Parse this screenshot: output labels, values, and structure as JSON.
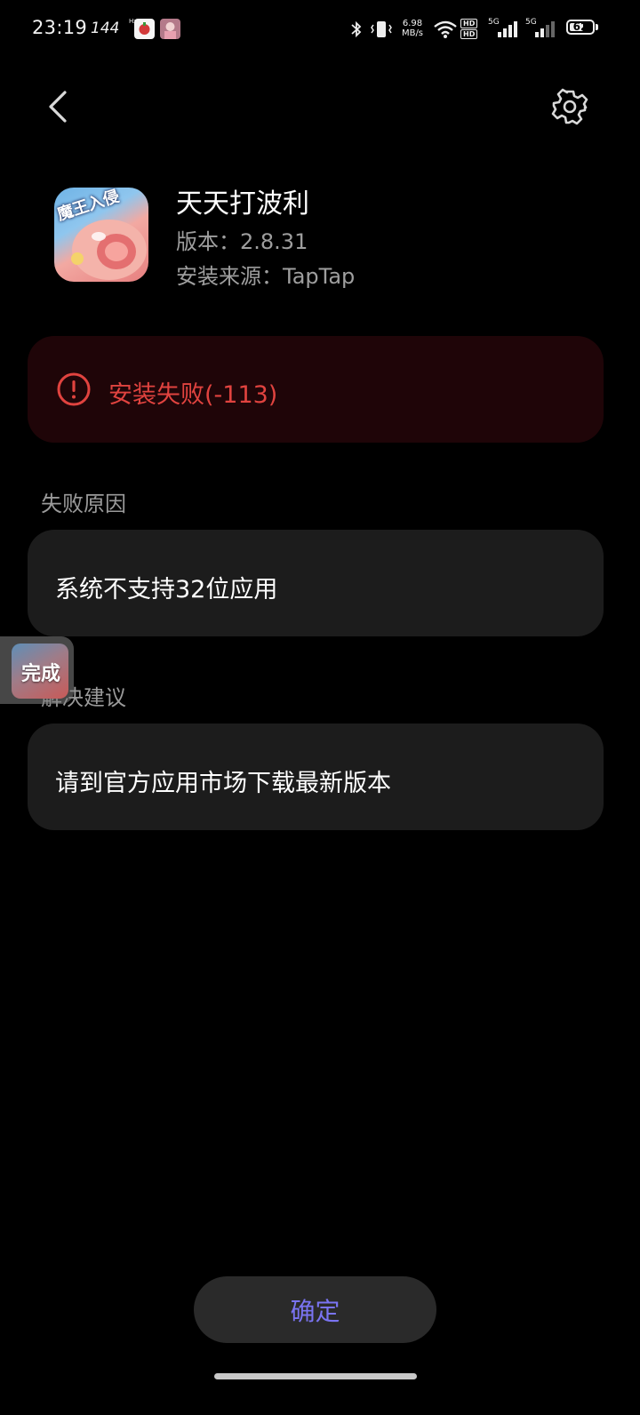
{
  "status_bar": {
    "time": "23:19",
    "refresh_rate": "144",
    "refresh_unit_top": "Hz",
    "net_speed_value": "6.98",
    "net_speed_unit": "MB/s",
    "hd1": "HD",
    "hd2": "HD",
    "signal1_label": "5G",
    "signal2_label": "5G",
    "battery_level": "62",
    "battery_fraction": 0.62,
    "icons": [
      "notification-app-icon",
      "notification-avatar-icon",
      "bluetooth-icon",
      "vibrate-icon",
      "wifi-icon",
      "hd-voice-icon",
      "signal-icon",
      "signal-icon",
      "battery-icon"
    ]
  },
  "header": {
    "back_icon": "chevron-left-icon",
    "settings_icon": "gear-icon"
  },
  "app": {
    "name": "天天打波利",
    "version_label": "版本：",
    "version": "2.8.31",
    "source_label": "安装来源：",
    "source": "TapTap",
    "icon_text": "魔王入侵"
  },
  "error": {
    "message": "安装失败(-113)",
    "icon": "exclamation-circle-icon",
    "color": "#e0433f",
    "background": "#1f0508"
  },
  "reason": {
    "label": "失败原因",
    "text": "系统不支持32位应用"
  },
  "suggestion": {
    "label": "解决建议",
    "text": "请到官方应用市场下载最新版本"
  },
  "floating_chip": {
    "label": "完成"
  },
  "confirm_button": {
    "label": "确定",
    "color": "#7a74f2"
  }
}
